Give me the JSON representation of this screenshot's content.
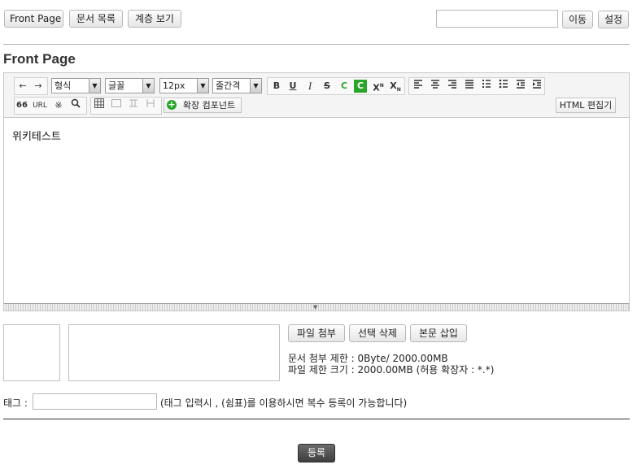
{
  "top_nav": {
    "front_page": "Front Page",
    "doc_list": "문서 목록",
    "tree_view": "계층 보기",
    "go_button": "이동",
    "settings_button": "설정",
    "search_value": ""
  },
  "page_title": "Front Page",
  "toolbar": {
    "undo_icon": "←",
    "redo_icon": "→",
    "format_select": "형식",
    "font_select": "글꼴",
    "size_select": "12px",
    "line_height_select": "줄간격",
    "bold": "B",
    "underline": "U",
    "italic": "I",
    "strike": "S",
    "font_color": "C",
    "bg_color": "C",
    "superscript": "X",
    "subscript": "X",
    "quote": "66",
    "url": "URL",
    "special_char": "※",
    "find": "🔍",
    "extension_button": "확장 컴포넌트",
    "html_edit_button": "HTML 편집기",
    "accent_green": "#2aa52a"
  },
  "editor_content": "위키테스트",
  "attachments": {
    "attach_button": "파일 첨부",
    "delete_button": "선택 삭제",
    "insert_button": "본문 삽입",
    "limit_doc": "문서 첨부 제한 : 0Byte/ 2000.00MB",
    "limit_file": "파일 제한 크기 : 2000.00MB (허용 확장자 : *.*)"
  },
  "tag": {
    "label": "태그 :",
    "value": "",
    "hint": "(태그 입력시 , (쉼표)를 이용하시면 복수 등록이 가능합니다)"
  },
  "submit_button": "등록"
}
